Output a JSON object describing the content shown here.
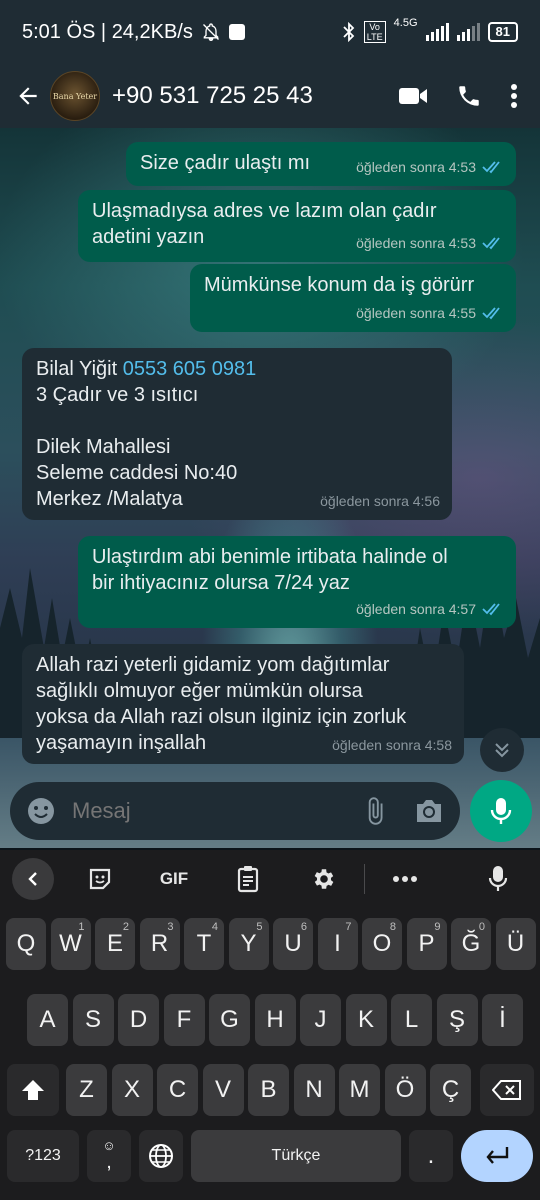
{
  "status_bar": {
    "time_speed": "5:01 ÖS | 24,2KB/s",
    "network": "4.5G",
    "volte": "Vo LTE",
    "battery": "81"
  },
  "app_bar": {
    "contact": "+90 531 725 25 43",
    "avatar_text": "Bana Yeter"
  },
  "messages": [
    {
      "dir": "out",
      "lines": [
        "Size çadır ulaştı mı"
      ],
      "time": "öğleden sonra 4:53"
    },
    {
      "dir": "out",
      "lines": [
        "Ulaşmadıysa adres ve lazım olan çadır",
        "adetini yazın"
      ],
      "time": "öğleden sonra 4:53"
    },
    {
      "dir": "out",
      "lines": [
        "Mümkünse konum da iş görürr"
      ],
      "time": "öğleden sonra 4:55"
    },
    {
      "dir": "in",
      "sender_line": "Bilal Yiğit",
      "phone_link": "0553 605 0981",
      "lines": [
        "3 Çadır ve 3 ısıtıcı",
        "",
        "Dilek Mahallesi",
        "Seleme caddesi No:40",
        "Merkez /Malatya"
      ],
      "time": "öğleden sonra 4:56"
    },
    {
      "dir": "out",
      "lines": [
        "Ulaştırdım abi benimle irtibata halinde ol",
        "bir ihtiyacınız olursa 7/24 yaz"
      ],
      "time": "öğleden sonra 4:57"
    },
    {
      "dir": "in",
      "lines": [
        "Allah razi yeterli gidamiz yom dağıtımlar",
        "sağlıklı olmuyor eğer mümkün olursa",
        "yoksa da Allah razi olsun ilginiz için zorluk",
        "yaşamayın inşallah"
      ],
      "time": "öğleden sonra 4:58"
    }
  ],
  "composer": {
    "placeholder": "Mesaj"
  },
  "keyboard": {
    "toolbar": {
      "gif": "GIF"
    },
    "row1": [
      {
        "k": "Q",
        "h": ""
      },
      {
        "k": "W",
        "h": "1"
      },
      {
        "k": "E",
        "h": "2"
      },
      {
        "k": "R",
        "h": "3"
      },
      {
        "k": "T",
        "h": "4"
      },
      {
        "k": "Y",
        "h": "5"
      },
      {
        "k": "U",
        "h": "6"
      },
      {
        "k": "I",
        "h": "7"
      },
      {
        "k": "O",
        "h": "8"
      },
      {
        "k": "P",
        "h": "9"
      },
      {
        "k": "Ğ",
        "h": "0"
      },
      {
        "k": "Ü",
        "h": ""
      }
    ],
    "row2": [
      "A",
      "S",
      "D",
      "F",
      "G",
      "H",
      "J",
      "K",
      "L",
      "Ş",
      "İ"
    ],
    "row3": [
      "Z",
      "X",
      "C",
      "V",
      "B",
      "N",
      "M",
      "Ö",
      "Ç"
    ],
    "symbols": "?123",
    "emoji_comma": ",",
    "space": "Türkçe",
    "period": "."
  }
}
